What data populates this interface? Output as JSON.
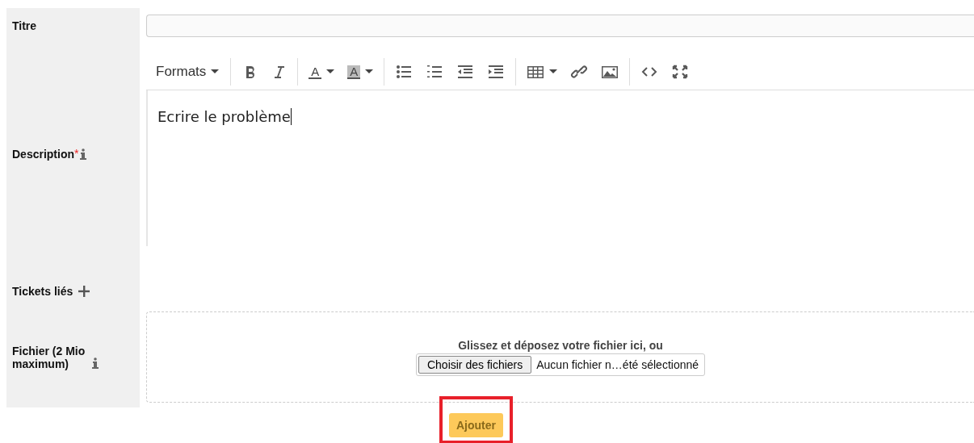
{
  "fields": [
    {
      "kind": "text",
      "label": "Titre"
    },
    {
      "kind": "editor",
      "label": "Description",
      "required_mark": "*",
      "icon": {
        "kind": "info"
      }
    },
    {
      "kind": "links",
      "label": "Tickets liés",
      "icon": {
        "kind": "add"
      }
    },
    {
      "kind": "file",
      "label": "Fichier (2 Mio maximum)",
      "icon": {
        "kind": "info"
      }
    }
  ],
  "editor": {
    "formats": "Formats",
    "groups": [
      [
        {
          "kind": "bold"
        },
        {
          "kind": "italic"
        }
      ],
      [
        {
          "kind": "text-color",
          "label": "A"
        },
        {
          "kind": "background-color",
          "label": "A"
        }
      ],
      [
        {
          "kind": "bullet-list"
        },
        {
          "kind": "numbered-list"
        },
        {
          "kind": "outdent"
        },
        {
          "kind": "indent"
        }
      ],
      [
        {
          "kind": "table"
        },
        {
          "kind": "link"
        },
        {
          "kind": "image"
        }
      ],
      [
        {
          "kind": "code"
        },
        {
          "kind": "fullscreen"
        }
      ]
    ],
    "content": "Ecrire le problème"
  },
  "file": {
    "drop_text": "Glissez et déposez votre fichier ici, ou",
    "choose_button": "Choisir des fichiers",
    "status": "Aucun fichier n…été sélectionné"
  },
  "submit": {
    "label": "Ajouter",
    "highlighted": true
  }
}
